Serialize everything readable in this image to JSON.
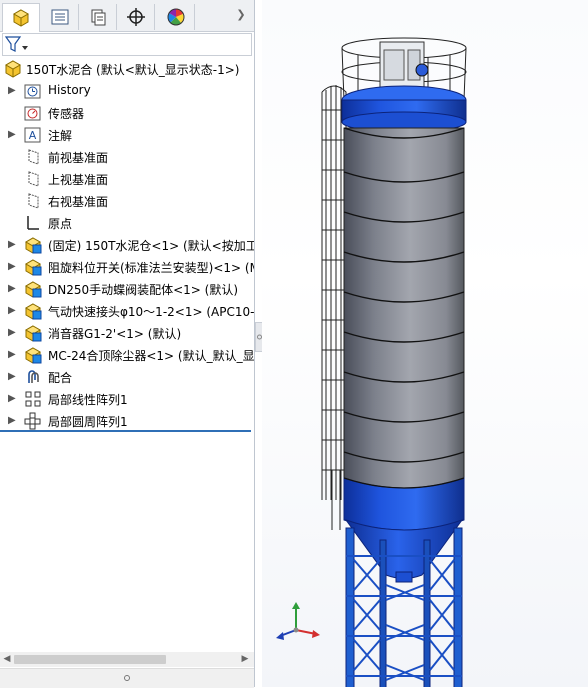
{
  "tabs": [
    {
      "name": "featuremanager-tab",
      "icon": "assembly-icon",
      "active": true
    },
    {
      "name": "propertymanager-tab",
      "icon": "list-icon",
      "active": false
    },
    {
      "name": "configurationmanager-tab",
      "icon": "configuration-icon",
      "active": false
    },
    {
      "name": "dimxpert-tab",
      "icon": "crosshair-icon",
      "active": false
    },
    {
      "name": "display-manager-tab",
      "icon": "color-wheel-icon",
      "active": false
    }
  ],
  "tree": {
    "root": "150T水泥合  (默认<默认_显示状态-1>)",
    "items": [
      {
        "label": "History",
        "icon": "history-icon",
        "expandable": true
      },
      {
        "label": "传感器",
        "icon": "sensor-icon",
        "expandable": false
      },
      {
        "label": "注解",
        "icon": "annotation-icon",
        "expandable": true
      },
      {
        "label": "前视基准面",
        "icon": "plane-icon",
        "expandable": false
      },
      {
        "label": "上视基准面",
        "icon": "plane-icon",
        "expandable": false
      },
      {
        "label": "右视基准面",
        "icon": "plane-icon",
        "expandable": false
      },
      {
        "label": "原点",
        "icon": "origin-icon",
        "expandable": false
      },
      {
        "label": "(固定) 150T水泥仓<1> (默认<按加工",
        "icon": "part-icon",
        "expandable": true
      },
      {
        "label": "阻旋料位开关(标准法兰安装型)<1> (M",
        "icon": "part-icon",
        "expandable": true
      },
      {
        "label": "DN250手动蝶阀装配体<1> (默认)",
        "icon": "part-icon",
        "expandable": true
      },
      {
        "label": "气动快速接头φ10～1-2<1> (APC10-(",
        "icon": "part-icon",
        "expandable": true
      },
      {
        "label": "消音器G1-2'<1> (默认)",
        "icon": "part-icon",
        "expandable": true
      },
      {
        "label": "MC-24合顶除尘器<1> (默认_默认_显",
        "icon": "part-icon",
        "expandable": true
      },
      {
        "label": "配合",
        "icon": "mate-icon",
        "expandable": true
      },
      {
        "label": "局部线性阵列1",
        "icon": "linear-pattern-icon",
        "expandable": true
      },
      {
        "label": "局部圆周阵列1",
        "icon": "circular-pattern-icon",
        "expandable": true
      }
    ]
  },
  "colors": {
    "accent": "#2f6fb6",
    "silo_blue": "#1e50d8",
    "silo_grey": "#8a8d96",
    "frame_blue": "#1f5fd0"
  }
}
